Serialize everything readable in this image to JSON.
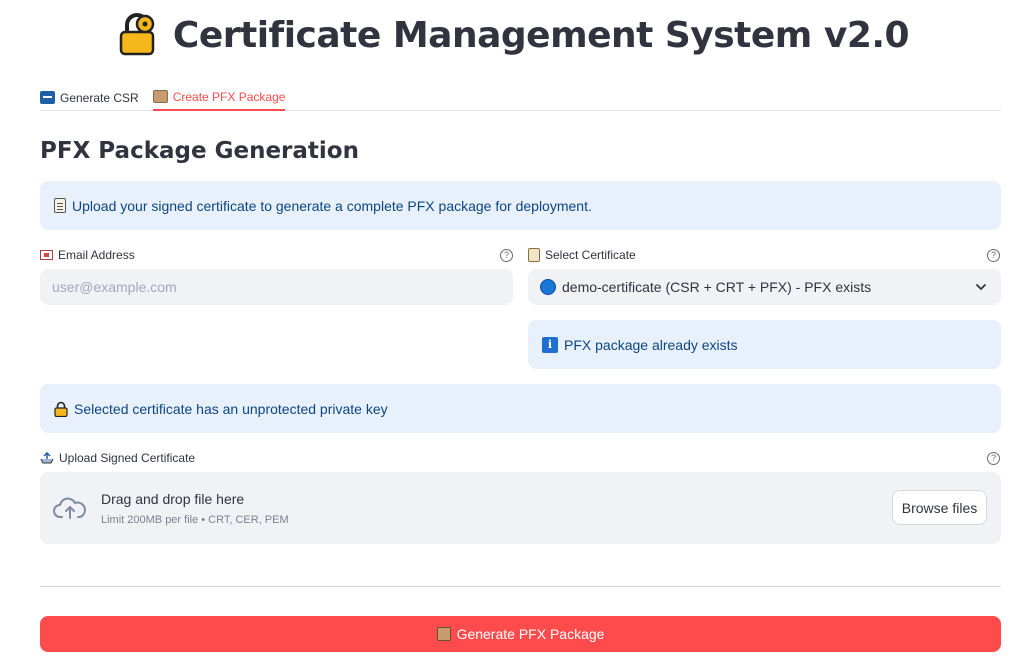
{
  "app": {
    "title": "Certificate Management System v2.0"
  },
  "tabs": [
    {
      "label": "Generate CSR",
      "icon": "csr-icon",
      "active": false
    },
    {
      "label": "Create PFX Package",
      "icon": "package-icon",
      "active": true
    }
  ],
  "section": {
    "title": "PFX Package Generation"
  },
  "info": {
    "upload_hint": "Upload your signed certificate to generate a complete PFX package for deployment.",
    "pfx_exists": "PFX package already exists",
    "unprotected_key": "Selected certificate has an unprotected private key"
  },
  "email": {
    "label": "Email Address",
    "placeholder": "user@example.com",
    "value": ""
  },
  "certificate_select": {
    "label": "Select Certificate",
    "selected": "demo-certificate (CSR + CRT + PFX) - PFX exists"
  },
  "upload": {
    "label": "Upload Signed Certificate",
    "drag_text": "Drag and drop file here",
    "limit_text": "Limit 200MB per file • CRT, CER, PEM",
    "browse_label": "Browse files"
  },
  "help_glyph": "?",
  "info_glyph": "i",
  "actions": {
    "generate_label": "Generate PFX Package"
  },
  "colors": {
    "accent": "#ff4b4b",
    "info_bg": "#e8f1fb",
    "info_text": "#0d4583",
    "input_bg": "#f0f2f6"
  }
}
